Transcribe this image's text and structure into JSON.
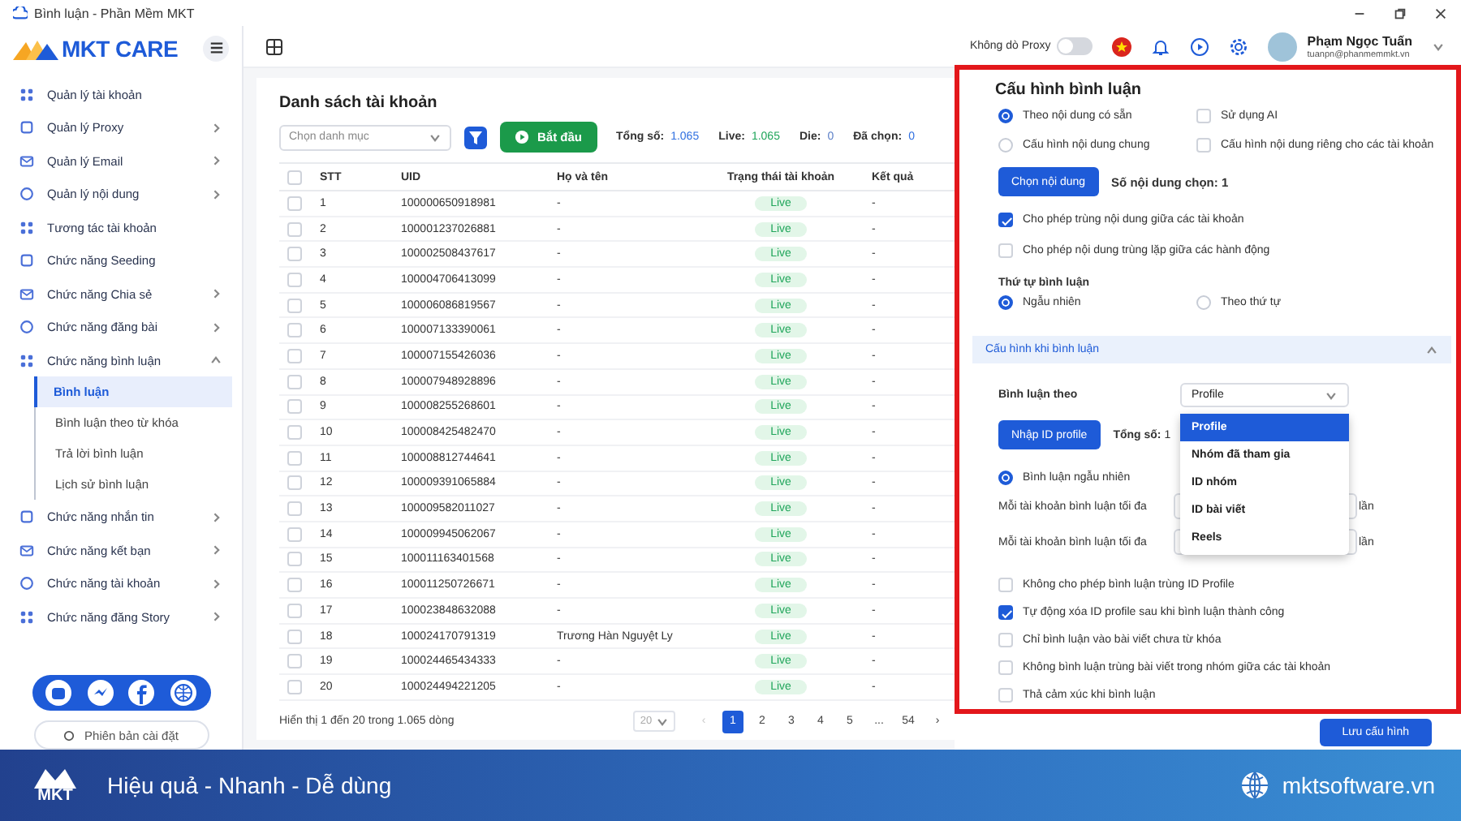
{
  "window": {
    "title": "Bình luận - Phần Mềm MKT"
  },
  "brand": {
    "name": "MKT CARE"
  },
  "sidebar": {
    "items": [
      {
        "label": "Quản lý tài khoản",
        "has_submenu": false
      },
      {
        "label": "Quản lý Proxy",
        "has_submenu": true
      },
      {
        "label": "Quản lý Email",
        "has_submenu": true
      },
      {
        "label": "Quản lý nội dung",
        "has_submenu": true
      },
      {
        "label": "Tương tác tài khoản",
        "has_submenu": false
      },
      {
        "label": "Chức năng Seeding",
        "has_submenu": false
      },
      {
        "label": "Chức năng Chia sẻ",
        "has_submenu": true
      },
      {
        "label": "Chức năng đăng bài",
        "has_submenu": true
      },
      {
        "label": "Chức năng bình luận",
        "has_submenu": true,
        "expanded": true,
        "children": [
          {
            "label": "Bình luận",
            "selected": true
          },
          {
            "label": "Bình luận theo từ khóa",
            "selected": false
          },
          {
            "label": "Trả lời bình luận",
            "selected": false
          },
          {
            "label": "Lịch sử bình luận",
            "selected": false
          }
        ]
      },
      {
        "label": "Chức năng nhắn tin",
        "has_submenu": true
      },
      {
        "label": "Chức năng kết bạn",
        "has_submenu": true
      },
      {
        "label": "Chức năng tài khoản",
        "has_submenu": true
      },
      {
        "label": "Chức năng đăng Story",
        "has_submenu": true
      }
    ],
    "version_button": "Phiên bản cài đặt"
  },
  "topbar": {
    "proxy": {
      "label": "Không dò Proxy",
      "on": false
    },
    "user": {
      "name": "Phạm Ngọc Tuấn",
      "email": "tuanpn@phanmemmkt.vn"
    }
  },
  "account_list": {
    "title": "Danh sách tài khoản",
    "category_select": {
      "placeholder": "Chọn danh mục"
    },
    "start_button": "Bắt đầu",
    "stats": [
      {
        "label": "Tổng số:",
        "value": "1.065",
        "color": "#2f6fe0"
      },
      {
        "label": "Live:",
        "value": "1.065",
        "color": "#1fa55a"
      },
      {
        "label": "Die:",
        "value": "0",
        "color": "#5b7fc7"
      },
      {
        "label": "Đã chọn:",
        "value": "0",
        "color": "#2f6fe0"
      }
    ],
    "table": {
      "select_all_checked": false,
      "columns": [
        "STT",
        "UID",
        "Họ và tên",
        "Trạng thái tài khoản",
        "Kết quả"
      ],
      "rows": [
        {
          "stt": "1",
          "uid": "100000650918981",
          "name": "-",
          "status": "Live",
          "result": "-",
          "checked": false
        },
        {
          "stt": "2",
          "uid": "100001237026881",
          "name": "-",
          "status": "Live",
          "result": "-",
          "checked": false
        },
        {
          "stt": "3",
          "uid": "100002508437617",
          "name": "-",
          "status": "Live",
          "result": "-",
          "checked": false
        },
        {
          "stt": "4",
          "uid": "100004706413099",
          "name": "-",
          "status": "Live",
          "result": "-",
          "checked": false
        },
        {
          "stt": "5",
          "uid": "100006086819567",
          "name": "-",
          "status": "Live",
          "result": "-",
          "checked": false
        },
        {
          "stt": "6",
          "uid": "100007133390061",
          "name": "-",
          "status": "Live",
          "result": "-",
          "checked": false
        },
        {
          "stt": "7",
          "uid": "100007155426036",
          "name": "-",
          "status": "Live",
          "result": "-",
          "checked": false
        },
        {
          "stt": "8",
          "uid": "100007948928896",
          "name": "-",
          "status": "Live",
          "result": "-",
          "checked": false
        },
        {
          "stt": "9",
          "uid": "100008255268601",
          "name": "-",
          "status": "Live",
          "result": "-",
          "checked": false
        },
        {
          "stt": "10",
          "uid": "100008425482470",
          "name": "-",
          "status": "Live",
          "result": "-",
          "checked": false
        },
        {
          "stt": "11",
          "uid": "100008812744641",
          "name": "-",
          "status": "Live",
          "result": "-",
          "checked": false
        },
        {
          "stt": "12",
          "uid": "100009391065884",
          "name": "-",
          "status": "Live",
          "result": "-",
          "checked": false
        },
        {
          "stt": "13",
          "uid": "100009582011027",
          "name": "-",
          "status": "Live",
          "result": "-",
          "checked": false
        },
        {
          "stt": "14",
          "uid": "100009945062067",
          "name": "-",
          "status": "Live",
          "result": "-",
          "checked": false
        },
        {
          "stt": "15",
          "uid": "100011163401568",
          "name": "-",
          "status": "Live",
          "result": "-",
          "checked": false
        },
        {
          "stt": "16",
          "uid": "100011250726671",
          "name": "-",
          "status": "Live",
          "result": "-",
          "checked": false
        },
        {
          "stt": "17",
          "uid": "100023848632088",
          "name": "-",
          "status": "Live",
          "result": "-",
          "checked": false
        },
        {
          "stt": "18",
          "uid": "100024170791319",
          "name": "Trương Hàn Nguyệt Ly",
          "status": "Live",
          "result": "-",
          "checked": false
        },
        {
          "stt": "19",
          "uid": "100024465434333",
          "name": "-",
          "status": "Live",
          "result": "-",
          "checked": false
        },
        {
          "stt": "20",
          "uid": "100024494221205",
          "name": "-",
          "status": "Live",
          "result": "-",
          "checked": false
        }
      ]
    },
    "footer": {
      "summary": "Hiển thị 1 đến 20 trong 1.065 dòng",
      "page_size": "20",
      "prev": "‹",
      "next": "›",
      "pages": [
        {
          "label": "1",
          "selected": true
        },
        {
          "label": "2",
          "selected": false
        },
        {
          "label": "3",
          "selected": false
        },
        {
          "label": "4",
          "selected": false
        },
        {
          "label": "5",
          "selected": false
        },
        {
          "label": "...",
          "selected": false
        },
        {
          "label": "54",
          "selected": false
        }
      ]
    }
  },
  "comment_config": {
    "title": "Cấu hình bình luận",
    "content_options": [
      {
        "kind": "radio",
        "label": "Theo nội dung có sẵn",
        "selected": true
      },
      {
        "kind": "checkbox",
        "label": "Sử dụng AI",
        "checked": false
      },
      {
        "kind": "radio",
        "label": "Cấu hình nội dung chung",
        "selected": false
      },
      {
        "kind": "checkbox",
        "label": "Cấu hình nội dung riêng cho các tài khoản",
        "checked": false
      }
    ],
    "choose_button": "Chọn nội dung",
    "chosen_count": "Số nội dung chọn: 1",
    "options": [
      {
        "label": "Cho phép trùng nội dung giữa các tài khoản",
        "checked": true
      },
      {
        "label": "Cho phép nội dung trùng lặp giữa các hành động",
        "checked": false
      }
    ],
    "order": {
      "label": "Thứ tự bình luận",
      "choices": [
        {
          "label": "Ngẫu nhiên",
          "selected": true
        },
        {
          "label": "Theo thứ tự",
          "selected": false
        }
      ]
    }
  },
  "comment_settings": {
    "title": "Cấu hình khi bình luận",
    "expanded": true,
    "target": {
      "label": "Bình luận theo",
      "value": "Profile",
      "open": true,
      "options": [
        {
          "label": "Profile",
          "selected": true
        },
        {
          "label": "Nhóm đã tham gia",
          "selected": false
        },
        {
          "label": "ID nhóm",
          "selected": false
        },
        {
          "label": "ID bài viết",
          "selected": false
        },
        {
          "label": "Reels",
          "selected": false
        }
      ]
    },
    "import_button": "Nhập ID profile",
    "total": "**Tổng số:** 1",
    "random_comment": {
      "label": "Bình luận ngẫu nhiên",
      "selected": true
    },
    "limits": [
      {
        "label": "Mỗi tài khoản bình luận tối đa",
        "unit": "lần"
      },
      {
        "label": "Mỗi tài khoản bình luận tối đa",
        "unit": "lần"
      }
    ],
    "options": [
      {
        "label": "Không cho phép bình luận trùng ID Profile",
        "checked": false
      },
      {
        "label": "Tự động xóa ID profile sau khi bình luận thành công",
        "checked": true
      },
      {
        "label": "Chỉ bình luận vào bài viết chưa từ khóa",
        "checked": false
      },
      {
        "label": "Không bình luận trùng bài viết trong nhóm giữa các tài khoản",
        "checked": false
      },
      {
        "label": "Thả cảm xúc khi bình luận",
        "checked": false
      }
    ]
  },
  "save_button": "Lưu cấu hình",
  "banner": {
    "logo": "MKT",
    "slogan": "Hiệu quả - Nhanh - Dễ dùng",
    "website": "mktsoftware.vn"
  }
}
